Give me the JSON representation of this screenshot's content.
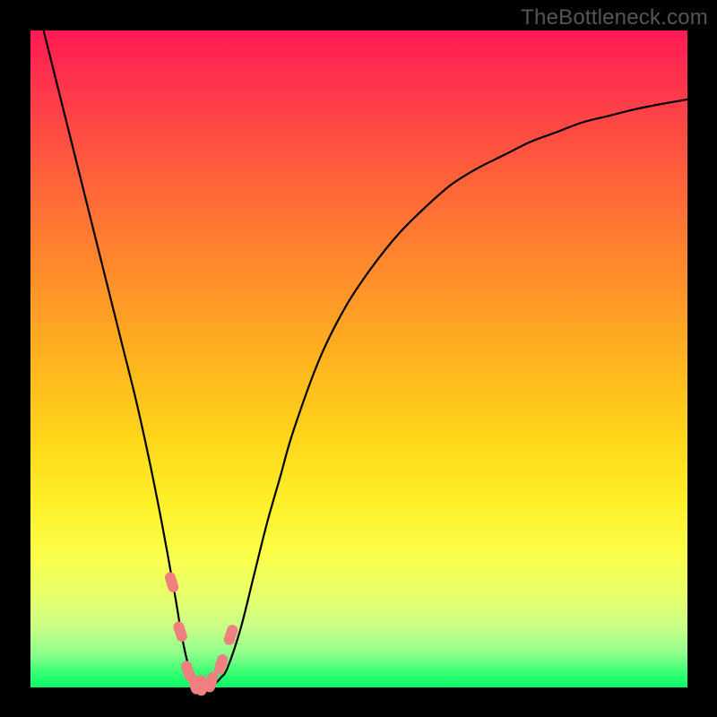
{
  "watermark": "TheBottleneck.com",
  "colors": {
    "background": "#000000",
    "gradient_top": "#ff1a54",
    "gradient_bottom": "#0cf565",
    "line": "#000000",
    "marker": "#f08080"
  },
  "chart_data": {
    "type": "line",
    "title": "",
    "xlabel": "",
    "ylabel": "",
    "xlim": [
      0,
      100
    ],
    "ylim": [
      0,
      100
    ],
    "x": [
      2,
      4,
      6,
      8,
      10,
      12,
      14,
      16,
      18,
      20,
      22,
      23,
      24,
      25,
      26,
      27,
      28,
      29,
      30,
      32,
      34,
      36,
      38,
      40,
      44,
      48,
      52,
      56,
      60,
      64,
      68,
      72,
      76,
      80,
      84,
      88,
      92,
      96,
      100
    ],
    "values": [
      100,
      92,
      84,
      76,
      68,
      60,
      52,
      44,
      35,
      25,
      14,
      8,
      3.5,
      1,
      0,
      0,
      0.5,
      1.5,
      3,
      9,
      17,
      25,
      32,
      39,
      50,
      58,
      64,
      69,
      73,
      76.5,
      79,
      81,
      83,
      84.5,
      86,
      87,
      88,
      88.8,
      89.5
    ],
    "markers_x": [
      21.5,
      22.8,
      24.0,
      25.0,
      26.0,
      27.5,
      29.0,
      30.5
    ],
    "markers_y": [
      16.0,
      8.5,
      2.5,
      0.5,
      0.3,
      0.8,
      3.5,
      8.0
    ],
    "annotations": []
  }
}
